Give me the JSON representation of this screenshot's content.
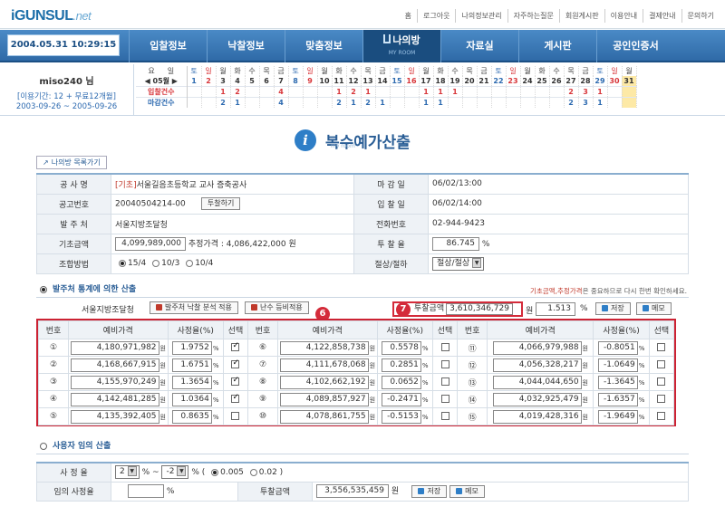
{
  "header": {
    "logo_main": "iGUNSUL",
    "logo_net": ".net",
    "links": [
      "홈",
      "로그아웃",
      "나의정보관리",
      "자주하는질문",
      "회원게시판",
      "이용안내",
      "결제안내",
      "문의하기"
    ]
  },
  "nav": {
    "datetime": "2004.05.31 10:29:15",
    "items": [
      "입찰정보",
      "낙찰정보",
      "맞춤정보",
      "나의방",
      "자료실",
      "게시판",
      "공인인증서"
    ],
    "active_sub": "MY ROOM"
  },
  "user": {
    "id": "miso240 님",
    "period": "[이용기간: 12 + 무료12개월]",
    "dates": "2003-09-26 ~ 2005-09-26"
  },
  "calendar": {
    "dow": [
      "요",
      "일",
      "토",
      "일",
      "월",
      "화",
      "수",
      "목",
      "금",
      "토",
      "일",
      "월",
      "화",
      "수",
      "목",
      "금",
      "토",
      "일",
      "월",
      "화",
      "수",
      "목",
      "금",
      "토",
      "일",
      "월",
      "화",
      "수",
      "목",
      "금",
      "토",
      "일",
      "월"
    ],
    "month": "◀ 05월 ▶",
    "days": [
      "1",
      "2",
      "3",
      "4",
      "5",
      "6",
      "7",
      "8",
      "9",
      "10",
      "11",
      "12",
      "13",
      "14",
      "15",
      "16",
      "17",
      "18",
      "19",
      "20",
      "21",
      "22",
      "23",
      "24",
      "25",
      "26",
      "27",
      "28",
      "29",
      "30",
      "31"
    ],
    "row1_label": "입찰건수",
    "row2_label": "마감건수",
    "row1": [
      "",
      "",
      "1",
      "2",
      "",
      "",
      "4",
      "",
      "",
      "",
      "1",
      "2",
      "1",
      "",
      "",
      "",
      "1",
      "1",
      "1",
      "",
      "",
      "",
      "",
      "",
      "",
      "",
      "2",
      "3",
      "1",
      "",
      ""
    ],
    "row2": [
      "",
      "",
      "2",
      "1",
      "",
      "",
      "4",
      "",
      "",
      "",
      "2",
      "1",
      "2",
      "1",
      "",
      "",
      "1",
      "1",
      "",
      "",
      "",
      "",
      "",
      "",
      "",
      "",
      "2",
      "3",
      "1",
      "",
      ""
    ]
  },
  "page": {
    "title": "복수예가산출",
    "sub": "my room",
    "back_label": "나의방 목록가기"
  },
  "info": {
    "l1": "공 사 명",
    "v1_tag": "[기초]",
    "v1": "서울길음초등학교 교사 증축공사",
    "r1": "마 감 일",
    "rv1": "06/02/13:00",
    "l2": "공고번호",
    "v2": "20040504214-00",
    "v2_btn": "투찰하기",
    "r2": "입 찰 일",
    "rv2": "06/02/14:00",
    "l3": "발 주 처",
    "v3": "서울지방조달청",
    "r3": "전화번호",
    "rv3": "02-944-9423",
    "l4": "기초금액",
    "v4": "4,099,989,000",
    "v4_est": "추정가격 : 4,086,422,000 원",
    "r4": "투 찰 율",
    "rv4": "86.745",
    "rv4_unit": "%",
    "l5": "조합방법",
    "v5_opts": [
      "15/4",
      "10/3",
      "10/4"
    ],
    "r5": "절상/절하",
    "rv5": "절상/절상"
  },
  "sec1": {
    "title": "발주처 통계에 의한 산출",
    "note_red": "기초금액,추정가격",
    "note": "은 중요하므로 다시 한번 확인하세요.",
    "agency": "서울지방조달청",
    "btn1": "발주처 낙찰 분석 적용",
    "btn2": "난수 등비적용",
    "bid_label": "투찰금액",
    "bid_value": "3,610,346,729",
    "won": "원",
    "rate": "1.513",
    "pct": "%",
    "save": "저장",
    "memo": "메모"
  },
  "badges": {
    "six": "6",
    "seven": "7"
  },
  "grid": {
    "headers": [
      "번호",
      "예비가격",
      "사정율(%)",
      "선택"
    ],
    "won": "원",
    "pct": "%",
    "rows": [
      [
        {
          "no": "①",
          "price": "4,180,971,982",
          "rate": "1.9752",
          "on": true
        },
        {
          "no": "⑥",
          "price": "4,122,858,738",
          "rate": "0.5578",
          "on": false
        },
        {
          "no": "⑪",
          "price": "4,066,979,988",
          "rate": "-0.8051",
          "on": false
        }
      ],
      [
        {
          "no": "②",
          "price": "4,168,667,915",
          "rate": "1.6751",
          "on": true
        },
        {
          "no": "⑦",
          "price": "4,111,678,068",
          "rate": "0.2851",
          "on": false
        },
        {
          "no": "⑫",
          "price": "4,056,328,217",
          "rate": "-1.0649",
          "on": false
        }
      ],
      [
        {
          "no": "③",
          "price": "4,155,970,249",
          "rate": "1.3654",
          "on": true
        },
        {
          "no": "⑧",
          "price": "4,102,662,192",
          "rate": "0.0652",
          "on": false
        },
        {
          "no": "⑬",
          "price": "4,044,044,650",
          "rate": "-1.3645",
          "on": false
        }
      ],
      [
        {
          "no": "④",
          "price": "4,142,481,285",
          "rate": "1.0364",
          "on": true
        },
        {
          "no": "⑨",
          "price": "4,089,857,927",
          "rate": "-0.2471",
          "on": false
        },
        {
          "no": "⑭",
          "price": "4,032,925,479",
          "rate": "-1.6357",
          "on": false
        }
      ],
      [
        {
          "no": "⑤",
          "price": "4,135,392,405",
          "rate": "0.8635",
          "on": false
        },
        {
          "no": "⑩",
          "price": "4,078,861,755",
          "rate": "-0.5153",
          "on": false
        },
        {
          "no": "⑮",
          "price": "4,019,428,316",
          "rate": "-1.9649",
          "on": false
        }
      ]
    ]
  },
  "sec2": {
    "title": "사용자 임의 산출",
    "l1": "사 정 율",
    "from": "2",
    "to": "-2",
    "pct_open": "% (",
    "opt1": "0.005",
    "opt2": "0.02 )",
    "tilde": "% ~",
    "l2": "임의 사정율",
    "pct": "%",
    "l3": "투찰금액",
    "amount": "3,556,535,459",
    "won": "원",
    "save": "저장",
    "memo": "메모"
  }
}
